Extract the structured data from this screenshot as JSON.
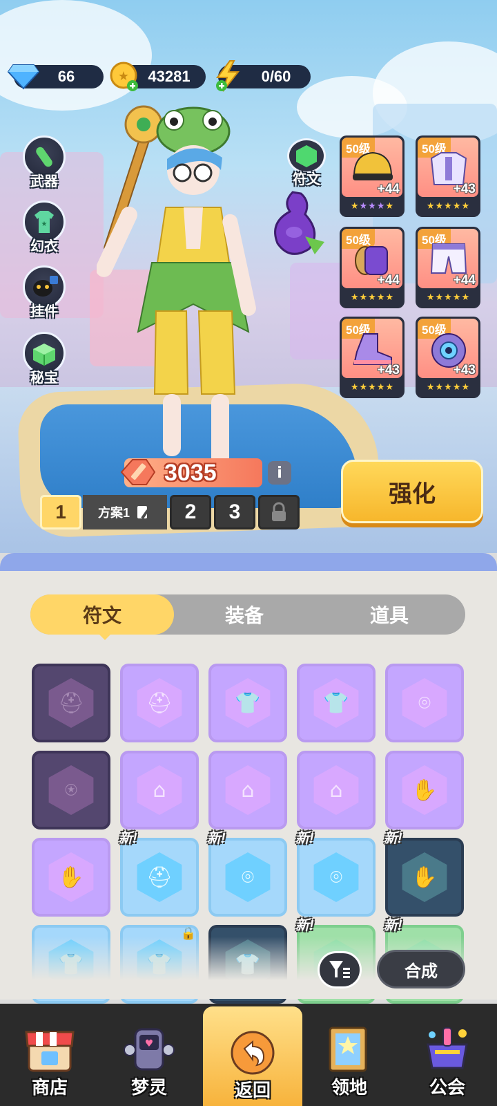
{
  "resources": {
    "gems": "66",
    "coins": "43281",
    "energy": "0/60"
  },
  "side_menu": [
    {
      "label": "武器",
      "icon": "weapon-icon"
    },
    {
      "label": "幻衣",
      "icon": "costume-icon"
    },
    {
      "label": "挂件",
      "icon": "pendant-icon"
    },
    {
      "label": "秘宝",
      "icon": "treasure-icon"
    }
  ],
  "rune": {
    "label": "符文"
  },
  "equipment": [
    {
      "level": "50级",
      "plus": "+44",
      "stars": 5,
      "color": "#ff9a8a"
    },
    {
      "level": "50级",
      "plus": "+43",
      "stars": 5,
      "color": "#ff9a8a"
    },
    {
      "level": "50级",
      "plus": "+44",
      "stars": 5,
      "color": "#ff9a8a"
    },
    {
      "level": "50级",
      "plus": "+44",
      "stars": 5,
      "color": "#ff9a8a"
    },
    {
      "level": "50级",
      "plus": "+43",
      "stars": 5,
      "color": "#ff9a8a"
    },
    {
      "level": "50级",
      "plus": "+43",
      "stars": 5,
      "color": "#ff9a8a"
    }
  ],
  "power": "3035",
  "plans": {
    "p1": "1",
    "p1_name": "方案1",
    "p2": "2",
    "p3": "3"
  },
  "strengthen_label": "强化",
  "tabs": [
    "符文",
    "装备",
    "道具"
  ],
  "active_tab": "符文",
  "new_label": "新!",
  "inventory": [
    {
      "rarity": "epic-dark",
      "item": "helmet",
      "new": false
    },
    {
      "rarity": "epic",
      "item": "helmet",
      "new": false
    },
    {
      "rarity": "epic",
      "item": "armor",
      "new": false
    },
    {
      "rarity": "epic",
      "item": "armor",
      "new": false
    },
    {
      "rarity": "epic",
      "item": "bracer",
      "new": false
    },
    {
      "rarity": "epic-dark",
      "item": "pants",
      "new": false
    },
    {
      "rarity": "epic",
      "item": "boots",
      "new": false
    },
    {
      "rarity": "epic",
      "item": "boots",
      "new": false
    },
    {
      "rarity": "epic",
      "item": "boots",
      "new": false
    },
    {
      "rarity": "epic",
      "item": "glove",
      "new": false
    },
    {
      "rarity": "epic",
      "item": "glove",
      "new": false
    },
    {
      "rarity": "rare",
      "item": "helmet",
      "new": true
    },
    {
      "rarity": "rare",
      "item": "bracer",
      "new": true
    },
    {
      "rarity": "rare",
      "item": "bracer",
      "new": true
    },
    {
      "rarity": "rare-dark",
      "item": "glove",
      "new": true
    },
    {
      "rarity": "rare",
      "item": "armor",
      "new": false
    },
    {
      "rarity": "rare",
      "item": "armor",
      "new": false,
      "locked": true
    },
    {
      "rarity": "rare-dark",
      "item": "armor",
      "new": false
    },
    {
      "rarity": "green",
      "item": "armor",
      "new": true
    },
    {
      "rarity": "green",
      "item": "armor",
      "new": true
    }
  ],
  "combine_label": "合成",
  "bottom_nav": [
    {
      "label": "商店",
      "icon": "shop-icon"
    },
    {
      "label": "梦灵",
      "icon": "spirit-icon"
    },
    {
      "label": "返回",
      "icon": "back-icon",
      "active": true
    },
    {
      "label": "领地",
      "icon": "territory-icon"
    },
    {
      "label": "公会",
      "icon": "guild-icon"
    }
  ]
}
